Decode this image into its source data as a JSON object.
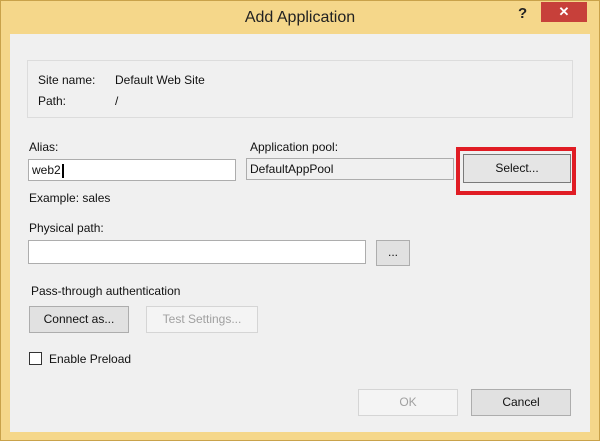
{
  "window": {
    "title": "Add Application",
    "help_label": "?",
    "close_label": "✕"
  },
  "site": {
    "name_label": "Site name:",
    "name_value": "Default Web Site",
    "path_label": "Path:",
    "path_value": "/"
  },
  "alias": {
    "label": "Alias:",
    "value": "web2",
    "example": "Example: sales"
  },
  "app_pool": {
    "label": "Application pool:",
    "value": "DefaultAppPool",
    "select_label": "Select..."
  },
  "physical_path": {
    "label": "Physical path:",
    "value": "",
    "browse_label": "..."
  },
  "auth": {
    "label": "Pass-through authentication",
    "connect_label": "Connect as...",
    "test_label": "Test Settings..."
  },
  "preload": {
    "label": "Enable Preload",
    "checked": false
  },
  "footer": {
    "ok_label": "OK",
    "cancel_label": "Cancel"
  },
  "colors": {
    "titlebar": "#f5d78a",
    "close": "#c7403a",
    "highlight": "#e01c24"
  }
}
